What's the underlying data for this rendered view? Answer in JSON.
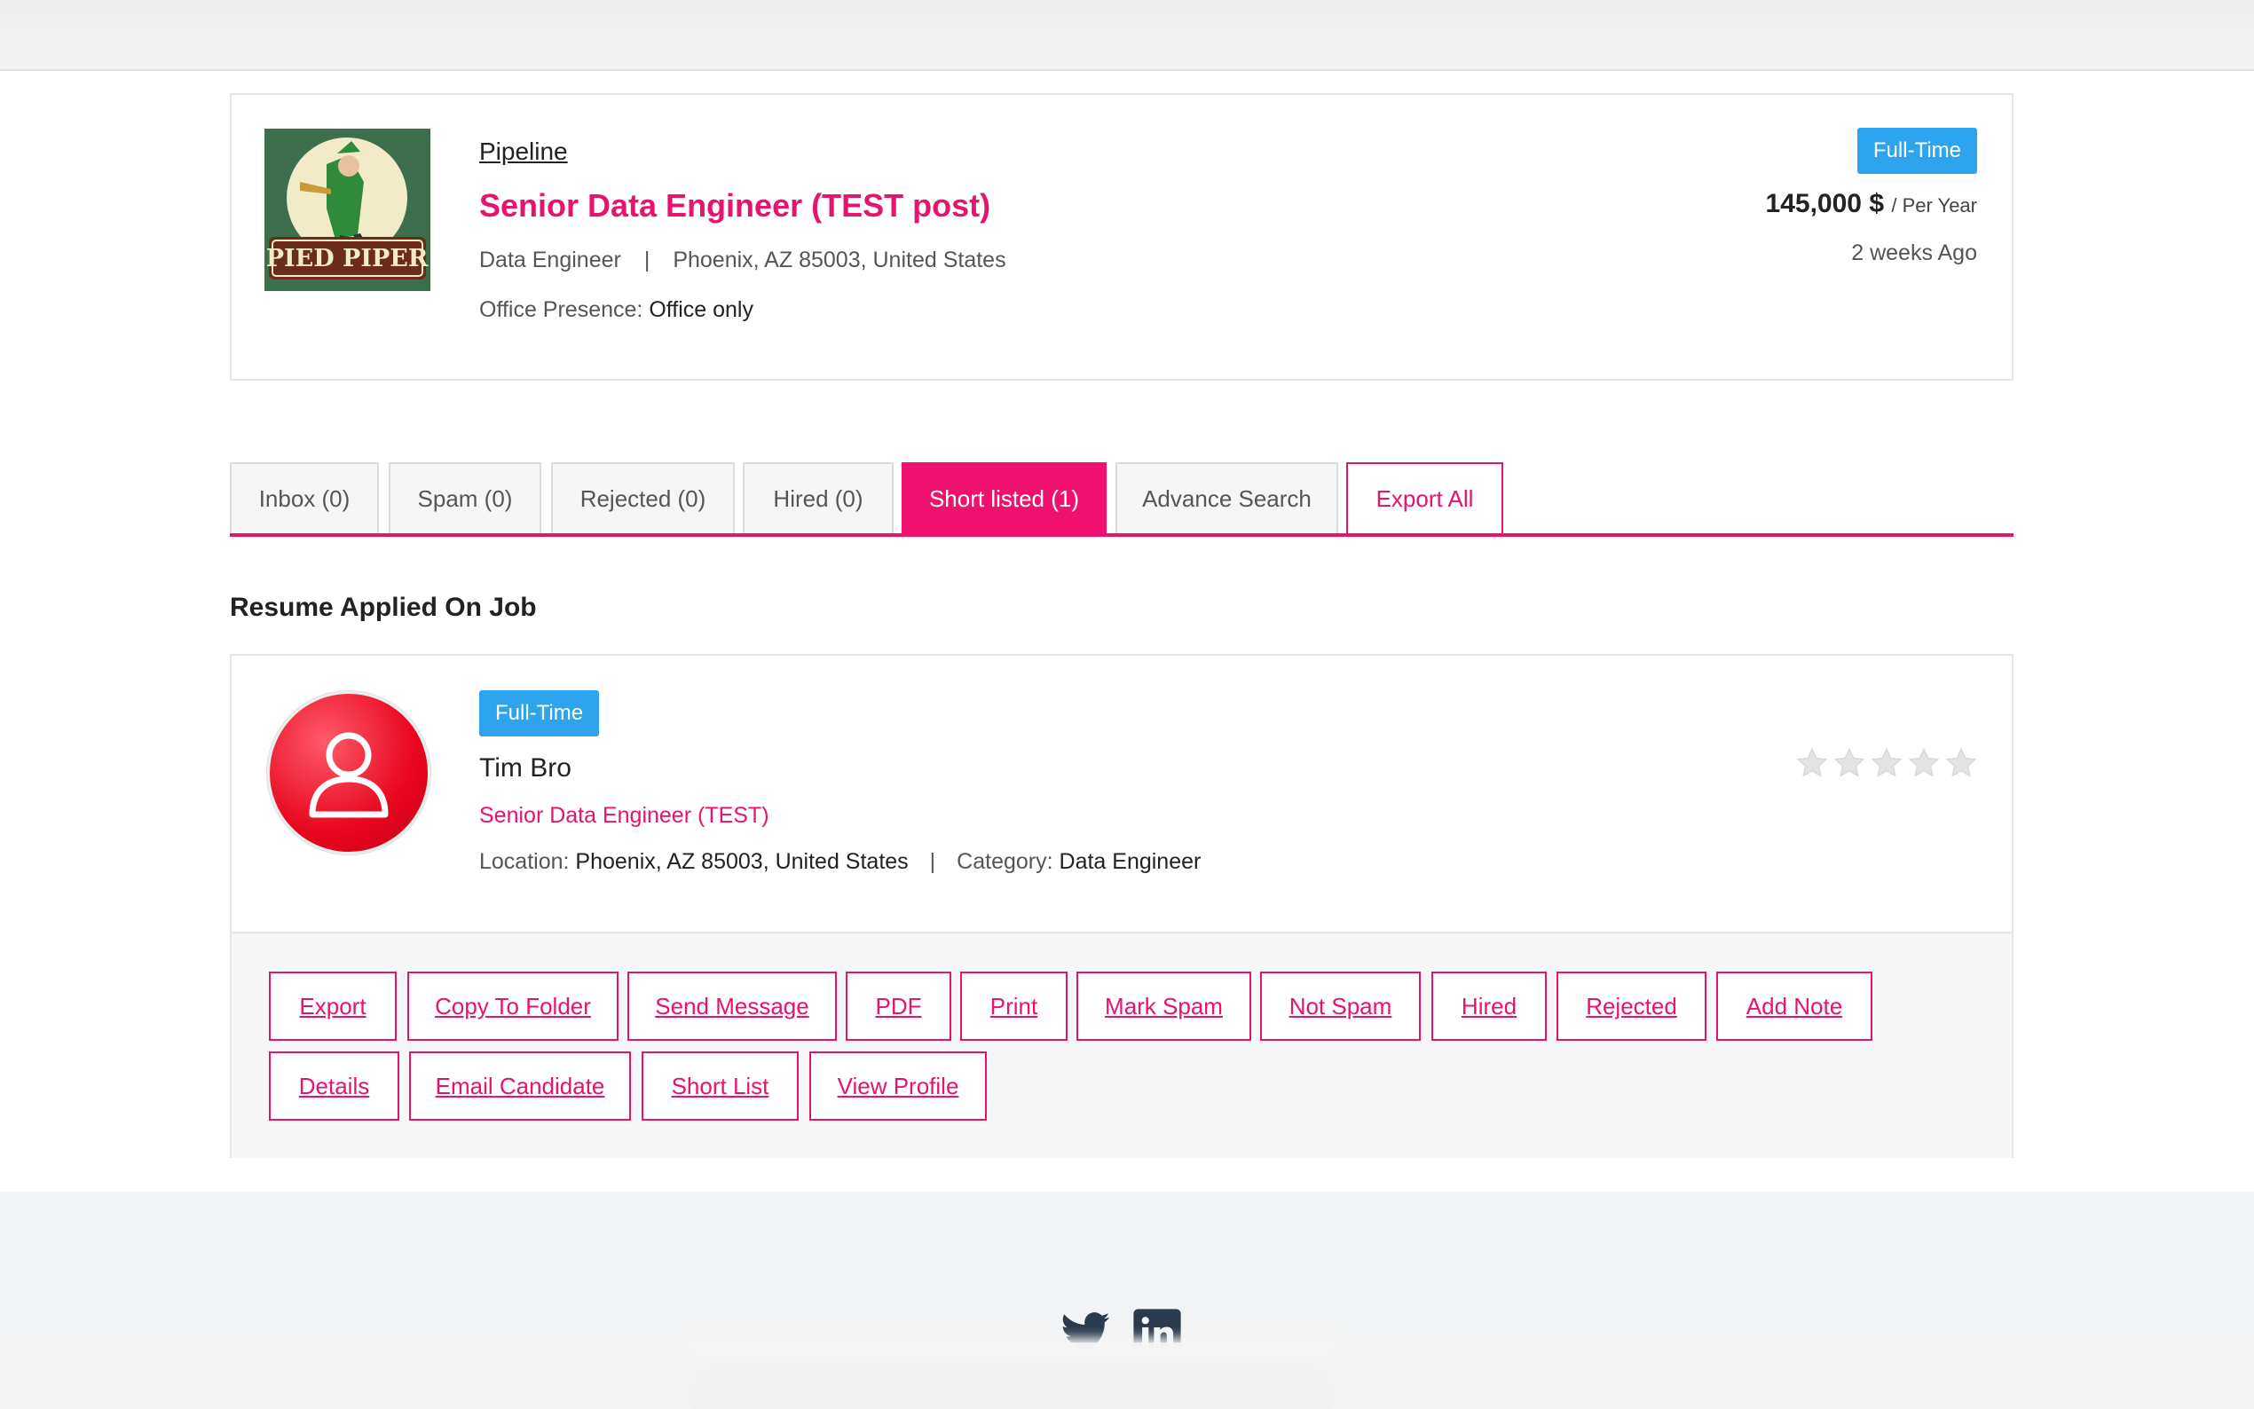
{
  "job": {
    "pipeline_link": "Pipeline",
    "title": "Senior Data Engineer (TEST post)",
    "category": "Data Engineer",
    "separator": "|",
    "location": "Phoenix, AZ 85003, United States",
    "presence_label": "Office Presence:",
    "presence_value": "Office only",
    "type_badge": "Full-Time",
    "salary": "145,000 $",
    "salary_period": "/ Per Year",
    "posted": "2 weeks Ago",
    "logo_text": "PIED PIPER"
  },
  "tabs": [
    {
      "label": "Inbox (0)"
    },
    {
      "label": "Spam (0)"
    },
    {
      "label": "Rejected (0)"
    },
    {
      "label": "Hired (0)"
    },
    {
      "label": "Short listed (1)",
      "active": true
    },
    {
      "label": "Advance Search"
    },
    {
      "label": "Export All"
    }
  ],
  "section_title": "Resume Applied On Job",
  "candidate": {
    "type_badge": "Full-Time",
    "name": "Tim Bro",
    "job_title": "Senior Data Engineer (TEST)",
    "location_label": "Location:",
    "location_value": "Phoenix, AZ 85003, United States",
    "separator": "|",
    "category_label": "Category:",
    "category_value": "Data Engineer",
    "rating": 0,
    "rating_max": 5
  },
  "actions": {
    "export": "Export",
    "copy_to_folder": "Copy To Folder",
    "send_message": "Send Message",
    "pdf": "PDF",
    "print": "Print",
    "mark_spam": "Mark Spam",
    "not_spam": "Not Spam",
    "hired": "Hired",
    "rejected": "Rejected",
    "add_note": "Add Note",
    "details": "Details",
    "email_candidate": "Email Candidate",
    "short_list": "Short List",
    "view_profile": "View Profile"
  },
  "colors": {
    "accent": "#e6136f",
    "badge_blue": "#2ea4ee",
    "star_gray": "#e3e3e3"
  },
  "footer": {
    "icons": [
      "twitter-icon",
      "linkedin-icon"
    ]
  }
}
